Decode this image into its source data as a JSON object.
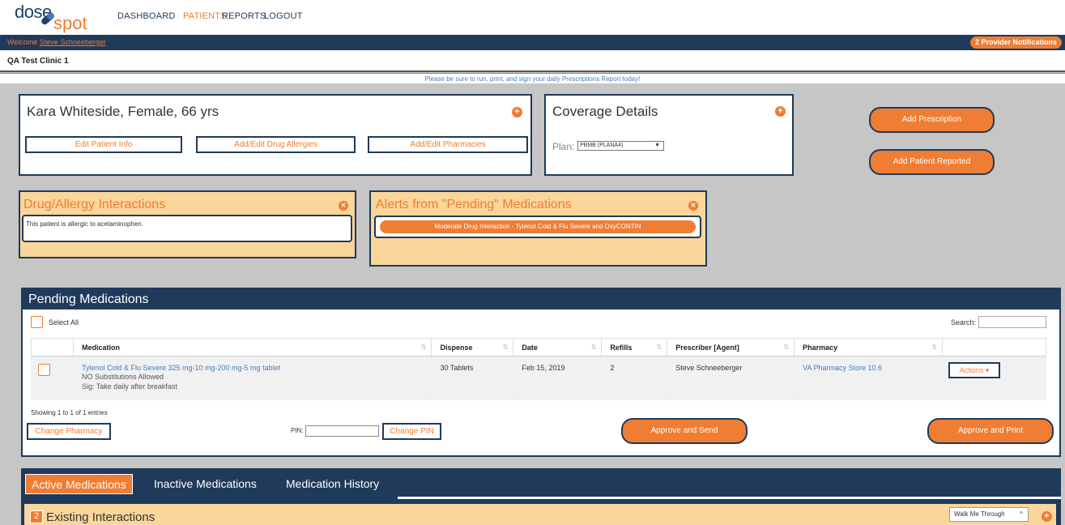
{
  "logo": {
    "dose": "dose",
    "spot": "spot"
  },
  "nav": [
    {
      "label": "DASHBOARD",
      "active": false
    },
    {
      "label": "PATIENTS",
      "active": true
    },
    {
      "label": "REPORTS",
      "active": false
    },
    {
      "label": "LOGOUT",
      "active": false
    }
  ],
  "welcome": {
    "prefix": "Welcome ",
    "user": "Steve Schneeberger"
  },
  "notifications": "2 Provider Notifications",
  "clinic": "QA Test Clinic 1",
  "reminder": "Please be sure to run, print, and sign your daily Prescriptions Report today!",
  "patient": {
    "header": "Kara Whiteside, Female, 66 yrs",
    "buttons": [
      "Edit Patient Info",
      "Add/Edit Drug Allergies",
      "Add/Edit Pharmacies"
    ]
  },
  "coverage": {
    "title": "Coverage Details",
    "plan_label": "Plan:",
    "plan_value": "PBMB (PLANA4)"
  },
  "actions": {
    "add_prescription": "Add Prescription",
    "add_patient_reported": "Add Patient Reported"
  },
  "allergy": {
    "title": "Drug/Allergy Interactions",
    "message": "This patient is allergic to acetaminophen."
  },
  "pending_alerts": {
    "title": "Alerts from \"Pending\" Medications",
    "alert": "Moderate Drug Interaction - Tylenol Cold & Flu Severe and OxyCONTIN"
  },
  "pending": {
    "title": "Pending Medications",
    "select_all": "Select All",
    "search_label": "Search:",
    "columns": [
      "Medication",
      "Dispense",
      "Date",
      "Refills",
      "Prescriber [Agent]",
      "Pharmacy"
    ],
    "rows": [
      {
        "medication": "Tylenol Cold & Flu Severe 325 mg-10 mg-200 mg-5 mg tablet",
        "note": "NO Substitutions Allowed",
        "sig": "Sig: Take daily after breakfast",
        "dispense": "30 Tablets",
        "date": "Feb 15, 2019",
        "refills": "2",
        "prescriber": "Steve Schneeberger",
        "pharmacy": "VA Pharmacy Store 10.6",
        "actions": "Actions ▾"
      }
    ],
    "showing": "Showing 1 to 1 of 1 entries",
    "change_pharmacy": "Change Pharmacy",
    "pin_label": "PIN:",
    "change_pin": "Change PIN",
    "approve_send": "Approve and Send",
    "approve_print": "Approve and Print"
  },
  "tabs": [
    {
      "label": "Active Medications",
      "active": true
    },
    {
      "label": "Inactive Medications",
      "active": false
    },
    {
      "label": "Medication History",
      "active": false
    }
  ],
  "existing": {
    "count": "2",
    "label": "Existing Interactions",
    "walk_me": "Walk Me Through"
  },
  "colors": {
    "navy": "#1f3a5a",
    "orange": "#ef7d33",
    "alert_bg": "#fad69b",
    "link": "#4a79b8"
  }
}
